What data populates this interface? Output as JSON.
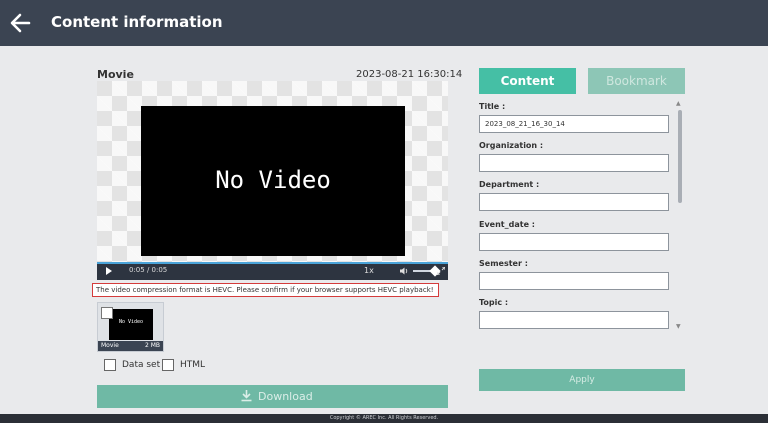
{
  "header": {
    "title": "Content information",
    "back_icon": "arrow-left-icon"
  },
  "media": {
    "title": "Movie",
    "timestamp": "2023-08-21  16:30:14",
    "placeholder_text": "No Video",
    "player": {
      "time_readout": "0:05  /  0:05",
      "speed": "1x",
      "progress_fraction": 1.0
    },
    "warning": "The video compression format is HEVC. Please confirm if your browser supports HEVC playback!",
    "thumbnail": {
      "name": "Movie",
      "size": "2 MB",
      "preview_text": "No Video"
    }
  },
  "options": {
    "dataset_label": "Data set",
    "html_label": "HTML"
  },
  "download": {
    "label": "Download"
  },
  "tabs": {
    "content": "Content",
    "bookmark": "Bookmark"
  },
  "form": {
    "fields": [
      {
        "label": "Title :",
        "value": "2023_08_21_16_30_14"
      },
      {
        "label": "Organization :",
        "value": ""
      },
      {
        "label": "Department :",
        "value": ""
      },
      {
        "label": "Event_date :",
        "value": ""
      },
      {
        "label": "Semester :",
        "value": ""
      },
      {
        "label": "Topic :",
        "value": ""
      }
    ]
  },
  "apply": {
    "label": "Apply"
  },
  "footer": {
    "text": "Copyright © AREC Inc. All Rights Reserved."
  },
  "colors": {
    "header_bg": "#3b4452",
    "accent": "#45bfa5",
    "accent_muted": "#6fb9a5",
    "warning_border": "#d43b3b"
  }
}
